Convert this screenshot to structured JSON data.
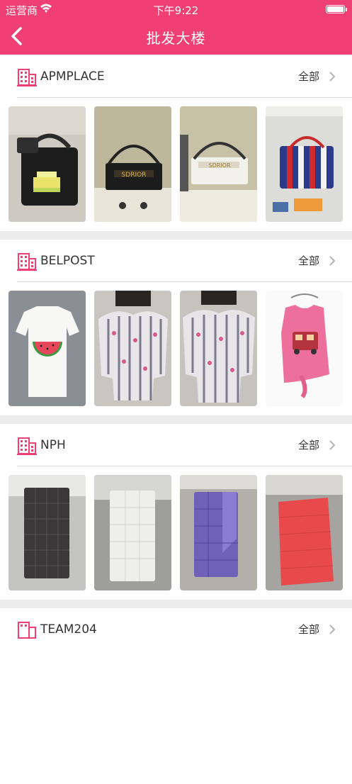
{
  "status_bar": {
    "carrier": "运营商",
    "time": "下午9:22"
  },
  "nav": {
    "title": "批发大楼",
    "back_icon": "chevron-left-icon"
  },
  "colors": {
    "brand": "#f03f72"
  },
  "sections": [
    {
      "name": "APMPLACE",
      "more_label": "全部"
    },
    {
      "name": "BELPOST",
      "more_label": "全部"
    },
    {
      "name": "NPH",
      "more_label": "全部"
    },
    {
      "name": "TEAM204",
      "more_label": "全部"
    }
  ],
  "product_images": [
    [
      "black-pixel-heart-bag-photo",
      "black-strap-bag-photo",
      "white-strap-bag-photo",
      "striped-tote-bag-photo"
    ],
    [
      "watermelon-tshirt-photo",
      "ruffle-top-photo",
      "ruffle-top-photo",
      "pink-print-tank-photo"
    ],
    [
      "black-croc-clutch-photo",
      "white-croc-clutch-photo",
      "purple-croc-wallet-photo",
      "red-leather-wallet-photo"
    ]
  ]
}
